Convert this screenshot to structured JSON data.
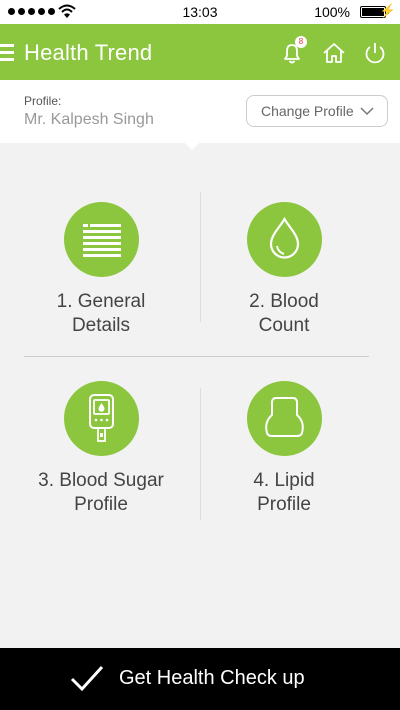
{
  "status_bar": {
    "time": "13:03",
    "battery": "100%"
  },
  "app_bar": {
    "title": "Health Trend",
    "notification_count": "8",
    "accent_color": "#8cc63f"
  },
  "profile": {
    "label": "Profile:",
    "name": "Mr. Kalpesh Singh",
    "change_button": "Change Profile"
  },
  "tiles": [
    {
      "label": "1. General\nDetails",
      "icon": "document-lines-icon"
    },
    {
      "label": "2. Blood\nCount",
      "icon": "blood-drop-icon"
    },
    {
      "label": "3. Blood Sugar\nProfile",
      "icon": "glucometer-icon"
    },
    {
      "label": "4. Lipid\nProfile",
      "icon": "lipid-icon"
    }
  ],
  "cta": {
    "label": "Get Health Check up",
    "icon": "checkmark-icon"
  }
}
